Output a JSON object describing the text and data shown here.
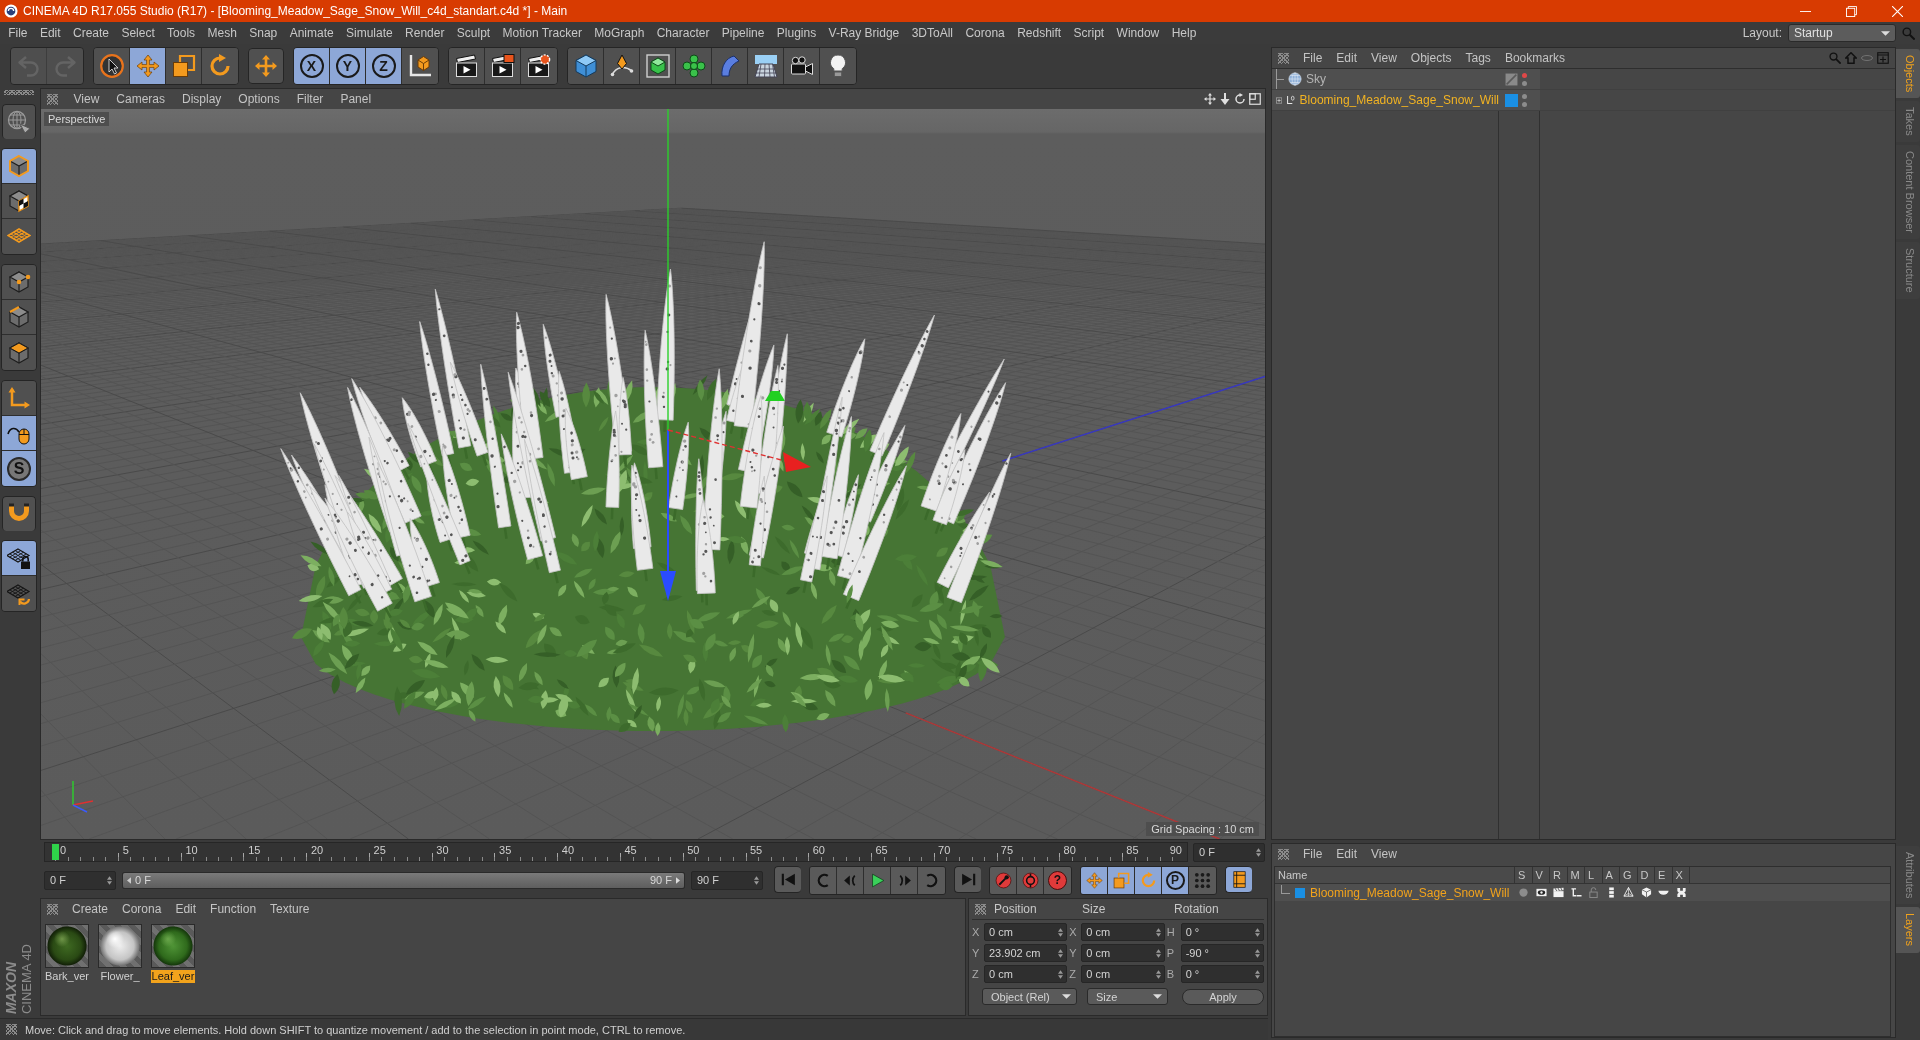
{
  "window": {
    "title": "CINEMA 4D R17.055 Studio (R17) - [Blooming_Meadow_Sage_Snow_Will_c4d_standart.c4d *] - Main"
  },
  "menu_bar": {
    "items": [
      "File",
      "Edit",
      "Create",
      "Select",
      "Tools",
      "Mesh",
      "Snap",
      "Animate",
      "Simulate",
      "Render",
      "Sculpt",
      "Motion Tracker",
      "MoGraph",
      "Character",
      "Pipeline",
      "Plugins",
      "V-Ray Bridge",
      "3DToAll",
      "Corona",
      "Redshift",
      "Script",
      "Window",
      "Help"
    ],
    "layout_label": "Layout:",
    "layout_value": "Startup"
  },
  "toolbar": {
    "groups": [
      {
        "buttons": [
          {
            "kind": "undo",
            "active": false,
            "disabled": true
          },
          {
            "kind": "redo",
            "active": false,
            "disabled": true
          }
        ]
      },
      {
        "buttons": [
          {
            "kind": "select",
            "active": false,
            "disabled": false
          },
          {
            "kind": "move",
            "active": true,
            "disabled": false
          },
          {
            "kind": "scale",
            "active": false,
            "disabled": false
          },
          {
            "kind": "rotate",
            "active": false,
            "disabled": false
          }
        ]
      },
      {
        "buttons": [
          {
            "kind": "transform",
            "active": false,
            "disabled": false
          }
        ]
      },
      {
        "buttons": [
          {
            "kind": "axis-lock",
            "label": "X",
            "active": true,
            "disabled": false
          },
          {
            "kind": "axis-lock",
            "label": "Y",
            "active": true,
            "disabled": false
          },
          {
            "kind": "axis-lock",
            "label": "Z",
            "active": true,
            "disabled": false
          },
          {
            "kind": "coordinate-system",
            "active": false,
            "disabled": false
          }
        ]
      },
      {
        "buttons": [
          {
            "kind": "render-view",
            "active": false,
            "disabled": false
          },
          {
            "kind": "render-picture",
            "active": false,
            "disabled": false
          },
          {
            "kind": "render-settings",
            "active": false,
            "disabled": false
          }
        ]
      },
      {
        "buttons": [
          {
            "kind": "cube",
            "active": false,
            "disabled": false
          },
          {
            "kind": "pen",
            "active": false,
            "disabled": false
          },
          {
            "kind": "subdivision",
            "active": false,
            "disabled": false
          },
          {
            "kind": "cloner",
            "active": false,
            "disabled": false
          },
          {
            "kind": "bend",
            "active": false,
            "disabled": false
          },
          {
            "kind": "floor",
            "active": false,
            "disabled": false
          },
          {
            "kind": "camera",
            "active": false,
            "disabled": false
          },
          {
            "kind": "light",
            "active": false,
            "disabled": false
          }
        ]
      }
    ]
  },
  "left_toolbar": {
    "groups": [
      {
        "buttons": [
          {
            "kind": "make-editable",
            "active": false
          }
        ]
      },
      {
        "buttons": [
          {
            "kind": "model",
            "active": true
          },
          {
            "kind": "texture",
            "active": false
          },
          {
            "kind": "workplane",
            "active": false
          }
        ]
      },
      {
        "buttons": [
          {
            "kind": "points",
            "active": false
          },
          {
            "kind": "edges",
            "active": false
          },
          {
            "kind": "polygons",
            "active": false
          }
        ]
      },
      {
        "buttons": [
          {
            "kind": "axis",
            "active": false
          },
          {
            "kind": "tweak",
            "active": true
          },
          {
            "kind": "snap",
            "label": "S",
            "active": true
          }
        ]
      },
      {
        "buttons": [
          {
            "kind": "magnet",
            "active": false
          }
        ]
      },
      {
        "buttons": [
          {
            "kind": "workplane-lock",
            "active": true
          },
          {
            "kind": "grid-rotate",
            "active": false
          }
        ]
      }
    ]
  },
  "logo": {
    "brand": "MAXON",
    "product": "CINEMA 4D"
  },
  "viewport": {
    "menu": [
      "View",
      "Cameras",
      "Display",
      "Options",
      "Filter",
      "Panel"
    ],
    "camera": "Perspective",
    "grid_spacing": "Grid Spacing : 10 cm"
  },
  "timeline": {
    "ruler_labels": [
      "0",
      "5",
      "10",
      "15",
      "20",
      "25",
      "30",
      "35",
      "40",
      "45",
      "50",
      "55",
      "60",
      "65",
      "70",
      "75",
      "80",
      "85",
      "90"
    ],
    "playhead": {
      "level": 0
    },
    "current_frame": "0 F",
    "start_field": "0 F",
    "range": {
      "start": "0 F",
      "end": "90 F",
      "level": 1
    },
    "end_field": "90 F",
    "transport": [
      {
        "buttons": [
          {
            "kind": "go-start",
            "active": false
          }
        ]
      },
      {
        "buttons": [
          {
            "kind": "prev-key",
            "active": false
          },
          {
            "kind": "prev-frame",
            "active": false
          },
          {
            "kind": "play",
            "active": false
          },
          {
            "kind": "next-frame",
            "active": false
          },
          {
            "kind": "next-key",
            "active": false
          }
        ]
      },
      {
        "buttons": [
          {
            "kind": "go-end",
            "active": false
          }
        ]
      },
      {
        "buttons": [
          {
            "kind": "record",
            "active": false
          },
          {
            "kind": "autokey",
            "active": false
          },
          {
            "kind": "keyframe-selection",
            "label": "?",
            "active": false
          }
        ]
      },
      {
        "buttons": [
          {
            "kind": "key-move",
            "active": true
          },
          {
            "kind": "key-scale",
            "active": true
          },
          {
            "kind": "key-rotate",
            "active": true
          },
          {
            "kind": "key-param",
            "label": "P",
            "active": true
          },
          {
            "kind": "key-points",
            "active": false
          }
        ]
      },
      {
        "buttons": [
          {
            "kind": "timeline",
            "active": true
          }
        ]
      }
    ]
  },
  "material_manager": {
    "menu": [
      "Create",
      "Corona",
      "Edit",
      "Function",
      "Texture"
    ],
    "materials": [
      {
        "name": "Bark_ver",
        "kind": "bark",
        "selected": false
      },
      {
        "name": "Flower_",
        "kind": "flower",
        "selected": false
      },
      {
        "name": "Leaf_ver",
        "kind": "leaf",
        "selected": true
      }
    ]
  },
  "coordinates": {
    "headers": [
      "Position",
      "Size",
      "Rotation"
    ],
    "rows": [
      [
        {
          "axis": "X",
          "value": "0 cm"
        },
        {
          "axis": "X",
          "value": "0 cm"
        },
        {
          "axis": "H",
          "value": "0 °"
        }
      ],
      [
        {
          "axis": "Y",
          "value": "23.902 cm"
        },
        {
          "axis": "Y",
          "value": "0 cm"
        },
        {
          "axis": "P",
          "value": "-90 °"
        }
      ],
      [
        {
          "axis": "Z",
          "value": "0 cm"
        },
        {
          "axis": "Z",
          "value": "0 cm"
        },
        {
          "axis": "B",
          "value": "0 °"
        }
      ]
    ],
    "dropdowns": [
      "Object (Rel)",
      "Size"
    ],
    "apply": "Apply"
  },
  "object_manager": {
    "menu": [
      "File",
      "Edit",
      "View",
      "Objects",
      "Tags",
      "Bookmarks"
    ],
    "objects": [
      {
        "name": "Sky",
        "kind": "sky",
        "selected": false,
        "expandable": false,
        "expanded": false,
        "tags": [
          {
            "kind": "compositing"
          }
        ],
        "dots": [
          {
            "color": "#e04848"
          },
          {
            "color": "#8c8c8c"
          }
        ]
      },
      {
        "name": "Blooming_Meadow_Sage_Snow_Will",
        "kind": "null",
        "selected": true,
        "expandable": true,
        "expanded": false,
        "tags": [
          {
            "kind": "layer",
            "color": "#1a8fe3"
          }
        ],
        "dots": [
          {
            "color": "#8c8c8c"
          },
          {
            "color": "#8c8c8c"
          }
        ]
      }
    ]
  },
  "layer_manager": {
    "menu": [
      "File",
      "Edit",
      "View"
    ],
    "columns": [
      "Name",
      "S",
      "V",
      "R",
      "M",
      "L",
      "A",
      "G",
      "D",
      "E",
      "X"
    ],
    "layers": [
      {
        "name": "Blooming_Meadow_Sage_Snow_Will",
        "color": "#1a8fe3",
        "selected": true,
        "flags": [
          {
            "kind": "solo",
            "on": false
          },
          {
            "kind": "visible",
            "on": true
          },
          {
            "kind": "render",
            "on": true
          },
          {
            "kind": "manager",
            "on": true
          },
          {
            "kind": "lock",
            "on": false
          },
          {
            "kind": "animation",
            "on": true
          },
          {
            "kind": "generators",
            "on": true
          },
          {
            "kind": "deformers",
            "on": true
          },
          {
            "kind": "expressions",
            "on": true
          },
          {
            "kind": "xref",
            "on": true
          }
        ]
      }
    ]
  },
  "side_tabs": {
    "top": [
      {
        "label": "Objects",
        "selected": true
      },
      {
        "label": "Takes",
        "selected": false
      },
      {
        "label": "Content Browser",
        "selected": false
      },
      {
        "label": "Structure",
        "selected": false
      }
    ],
    "bottom": [
      {
        "label": "Attributes",
        "selected": false
      },
      {
        "label": "Layers",
        "selected": true
      }
    ]
  },
  "status_bar": {
    "text": "Move: Click and drag to move elements. Hold down SHIFT to quantize movement / add to the selection in point mode, CTRL to remove."
  }
}
